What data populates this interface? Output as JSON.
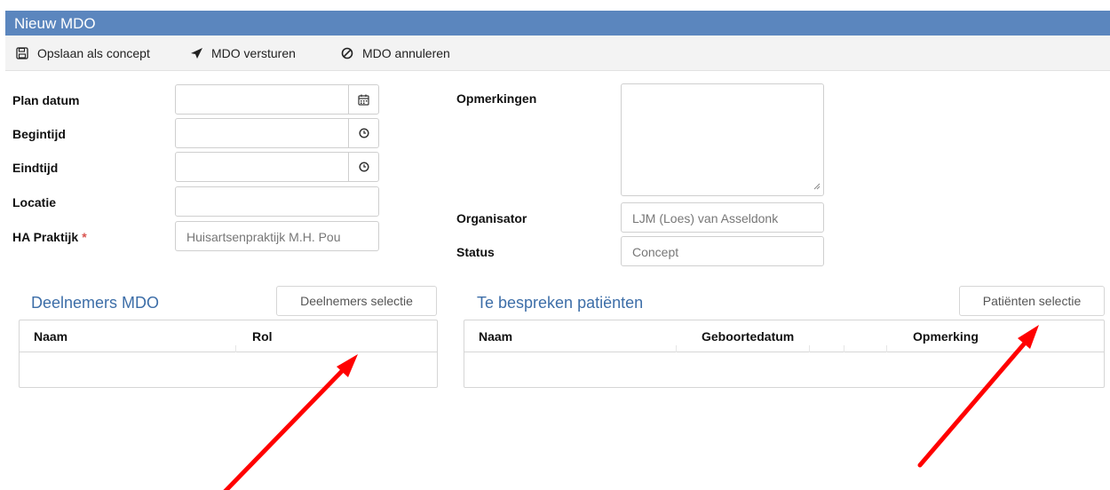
{
  "window": {
    "title": "Nieuw MDO"
  },
  "toolbar": {
    "save_draft": {
      "label": "Opslaan als concept",
      "icon": "floppy-disk-icon"
    },
    "send": {
      "label": "MDO versturen",
      "icon": "paper-plane-icon"
    },
    "cancel": {
      "label": "MDO annuleren",
      "icon": "ban-icon"
    }
  },
  "form": {
    "plan_datum": {
      "label": "Plan datum",
      "value": "",
      "icon": "calendar-icon"
    },
    "begintijd": {
      "label": "Begintijd",
      "value": "",
      "icon": "clock-icon"
    },
    "eindtijd": {
      "label": "Eindtijd",
      "value": "",
      "icon": "clock-icon"
    },
    "locatie": {
      "label": "Locatie",
      "value": ""
    },
    "ha_praktijk": {
      "label": "HA Praktijk",
      "required_mark": "*",
      "value": "Huisartsenpraktijk M.H. Pou"
    },
    "opmerkingen": {
      "label": "Opmerkingen",
      "value": ""
    },
    "organisator": {
      "label": "Organisator",
      "value": "LJM (Loes) van Asseldonk"
    },
    "status": {
      "label": "Status",
      "value": "Concept"
    }
  },
  "deelnemers": {
    "title": "Deelnemers MDO",
    "select_button": "Deelnemers selectie",
    "columns": [
      "Naam",
      "Rol"
    ],
    "rows": []
  },
  "patienten": {
    "title": "Te bespreken patiënten",
    "select_button": "Patiënten selectie",
    "columns": [
      "Naam",
      "Geboortedatum",
      "Opmerking"
    ],
    "rows": []
  },
  "colors": {
    "titlebar": "#5b86be",
    "section_title": "#3d6ea8",
    "annotation_arrow": "#ff0000",
    "required": "#d9534f"
  }
}
